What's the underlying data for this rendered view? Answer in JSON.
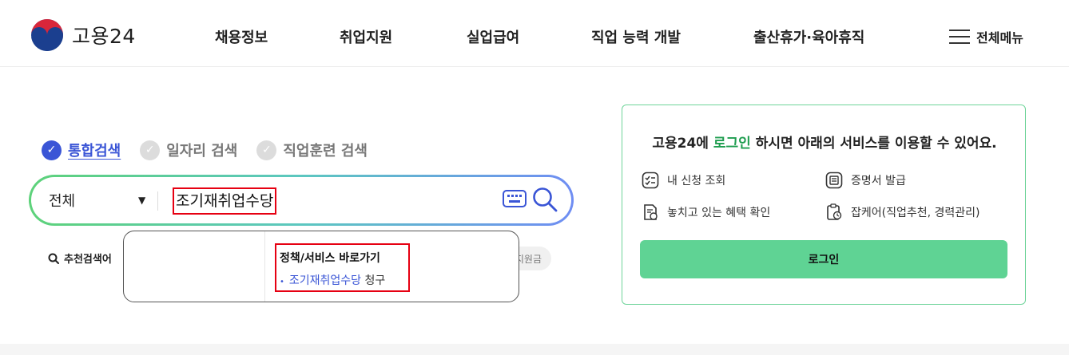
{
  "header": {
    "logo_text": "고용24",
    "nav": [
      "채용정보",
      "취업지원",
      "실업급여",
      "직업 능력 개발",
      "출산휴가·육아휴직"
    ],
    "menu_label": "전체메뉴"
  },
  "search": {
    "tabs": [
      {
        "label": "통합검색",
        "active": true
      },
      {
        "label": "일자리 검색",
        "active": false
      },
      {
        "label": "직업훈련 검색",
        "active": false
      }
    ],
    "scope": "전체",
    "query": "조기재취업수당",
    "recommend_label": "추천검색어",
    "peek_chip": "지원금"
  },
  "autocomplete": {
    "section_title": "정책/서비스 바로가기",
    "item_link": "조기재취업수당",
    "item_suffix": " 청구"
  },
  "login_card": {
    "title_prefix": "고용24에 ",
    "title_highlight": "로그인",
    "title_suffix": " 하시면 아래의 서비스를 이용할 수 있어요.",
    "services": [
      "내 신청 조회",
      "증명서 발급",
      "놓치고 있는 혜택 확인",
      "잡케어(직업추천, 경력관리)"
    ],
    "button_label": "로그인"
  },
  "colors": {
    "accent_blue": "#3a55d6",
    "accent_green": "#1e9d4f",
    "login_button": "#5fd394",
    "highlight_box": "#e60012"
  }
}
